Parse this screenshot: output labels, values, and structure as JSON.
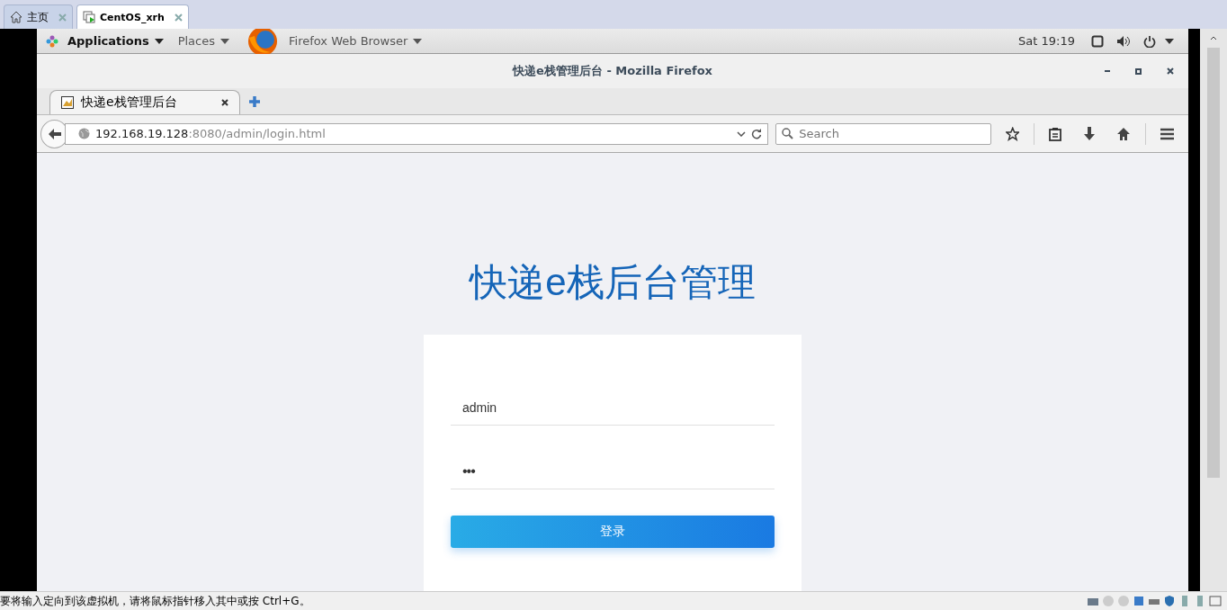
{
  "host_tabs": [
    {
      "label": "主页",
      "selected": false
    },
    {
      "label": "CentOS_xrh",
      "selected": true
    }
  ],
  "top_bar": {
    "menus": [
      "Applications",
      "Places",
      "Firefox Web Browser"
    ],
    "clock": "Sat 19:19"
  },
  "window": {
    "title": "快递e栈管理后台 - Mozilla Firefox"
  },
  "browser_tabs": [
    {
      "label": "快递e栈管理后台",
      "selected": true
    }
  ],
  "address": {
    "host": "192.168.19.128",
    "rest": ":8080/admin/login.html"
  },
  "search": {
    "placeholder": "Search"
  },
  "page": {
    "heading": "快递e栈后台管理",
    "fields": [
      {
        "kind": "text",
        "value": "admin"
      },
      {
        "kind": "password",
        "value": "•••"
      }
    ],
    "button": "登录"
  },
  "status_bar": {
    "text": "要将输入定向到该虚拟机，请将鼠标指针移入其中或按 Ctrl+G。"
  }
}
